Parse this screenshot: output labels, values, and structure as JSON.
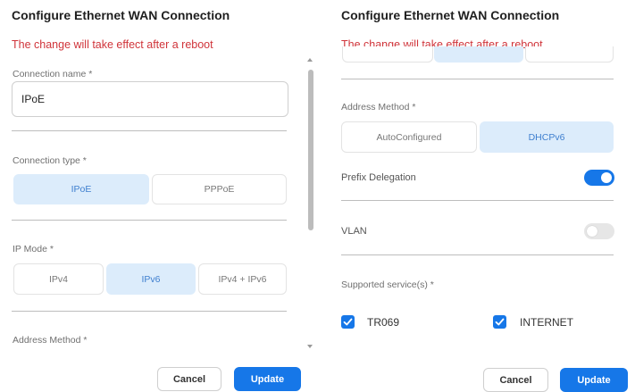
{
  "left": {
    "title": "Configure Ethernet WAN Connection",
    "warning": "The change will take effect after a reboot",
    "connection_name": {
      "label": "Connection name *",
      "value": "IPoE"
    },
    "connection_type": {
      "label": "Connection type *",
      "options": [
        "IPoE",
        "PPPoE"
      ],
      "selected": "IPoE"
    },
    "ip_mode": {
      "label": "IP Mode *",
      "options": [
        "IPv4",
        "IPv6",
        "IPv4 + IPv6"
      ],
      "selected": "IPv6"
    },
    "address_method_label": "Address Method *",
    "buttons": {
      "cancel": "Cancel",
      "update": "Update"
    }
  },
  "right": {
    "title": "Configure Ethernet WAN Connection",
    "warning": "The change will take effect after a reboot",
    "address_method": {
      "label": "Address Method *",
      "options": [
        "AutoConfigured",
        "DHCPv6"
      ],
      "selected": "DHCPv6"
    },
    "prefix_delegation": {
      "label": "Prefix Delegation",
      "enabled": true
    },
    "vlan": {
      "label": "VLAN",
      "enabled": false
    },
    "supported_services": {
      "label": "Supported service(s) *",
      "items": [
        {
          "label": "TR069",
          "checked": true
        },
        {
          "label": "INTERNET",
          "checked": true
        }
      ]
    },
    "buttons": {
      "cancel": "Cancel",
      "update": "Update"
    }
  },
  "colors": {
    "accent": "#1677e8",
    "warning": "#d0343a",
    "selected_bg": "#dcecfb",
    "selected_text": "#3f7fcf"
  },
  "icons": [
    "check-icon",
    "scroll-up-arrow-icon",
    "scroll-down-arrow-icon"
  ]
}
